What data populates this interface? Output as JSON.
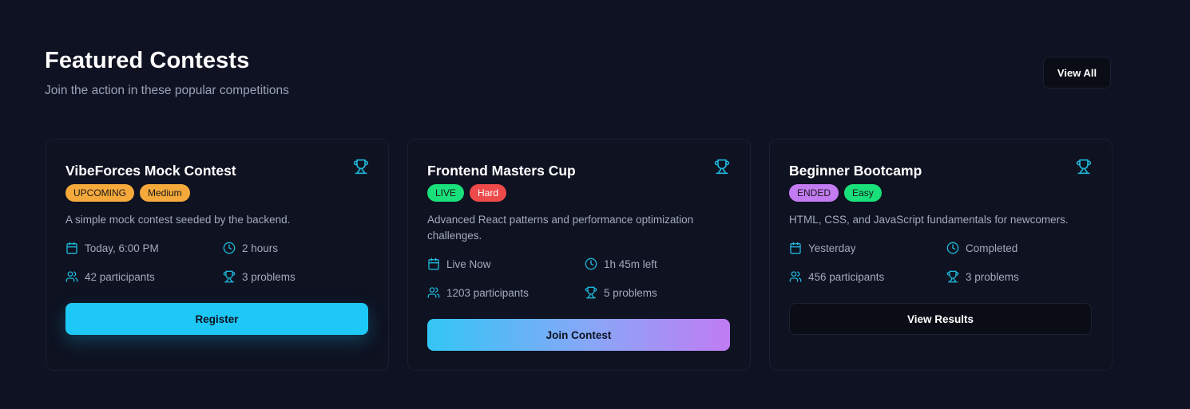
{
  "section": {
    "title": "Featured Contests",
    "subtitle": "Join the action in these popular competitions",
    "view_all_label": "View All"
  },
  "colors": {
    "accent": "#1fb6d8",
    "upcoming": "#f5a93b",
    "medium": "#f5a93b",
    "live": "#19e07a",
    "hard": "#ef4a4a",
    "ended": "#c37bf2",
    "easy": "#19e07a"
  },
  "cards": [
    {
      "title": "VibeForces Mock Contest",
      "status": "UPCOMING",
      "difficulty": "Medium",
      "description": "A simple mock contest seeded by the backend.",
      "date": "Today, 6:00 PM",
      "duration": "2 hours",
      "participants": "42 participants",
      "problems": "3 problems",
      "button": "Register"
    },
    {
      "title": "Frontend Masters Cup",
      "status": "LIVE",
      "difficulty": "Hard",
      "description": "Advanced React patterns and performance optimization challenges.",
      "date": "Live Now",
      "duration": "1h 45m left",
      "participants": "1203 participants",
      "problems": "5 problems",
      "button": "Join Contest"
    },
    {
      "title": "Beginner Bootcamp",
      "status": "ENDED",
      "difficulty": "Easy",
      "description": "HTML, CSS, and JavaScript fundamentals for newcomers.",
      "date": "Yesterday",
      "duration": "Completed",
      "participants": "456 participants",
      "problems": "3 problems",
      "button": "View Results"
    }
  ]
}
